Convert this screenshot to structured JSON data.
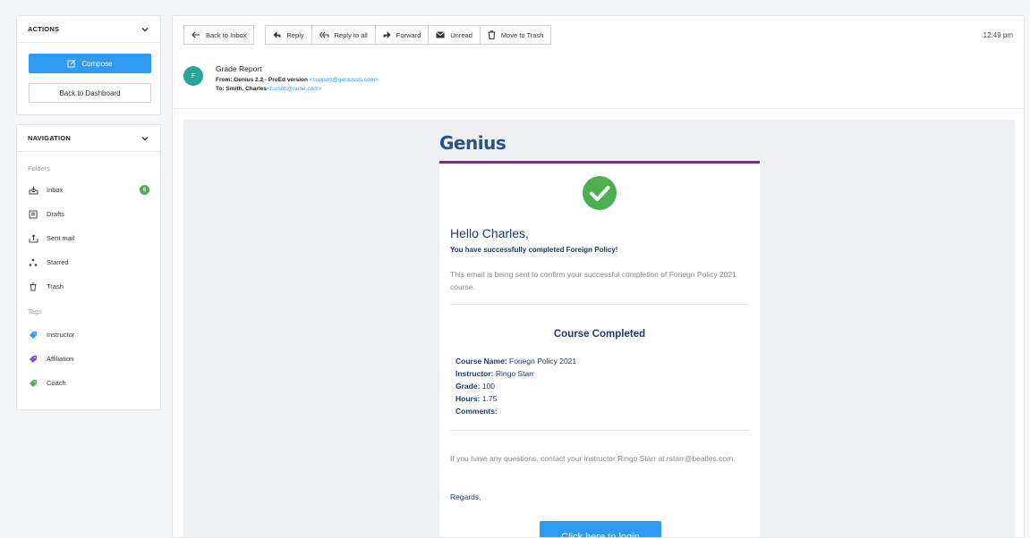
{
  "sidebar": {
    "actions": {
      "title": "ACTIONS",
      "compose_label": "Compose",
      "dashboard_label": "Back to Dashboard"
    },
    "navigation": {
      "title": "NAVIGATION",
      "folders_label": "Folders",
      "folders": [
        {
          "label": "Inbox",
          "icon": "inbox-icon",
          "badge": "6"
        },
        {
          "label": "Drafts",
          "icon": "drafts-icon"
        },
        {
          "label": "Sent mail",
          "icon": "sent-icon"
        },
        {
          "label": "Starred",
          "icon": "starred-icon"
        },
        {
          "label": "Trash",
          "icon": "trash-icon"
        }
      ],
      "tags_label": "Tags",
      "tags": [
        {
          "label": "Instructor",
          "color": "#2e9bf0"
        },
        {
          "label": "Affiliation",
          "color": "#7e57c2"
        },
        {
          "label": "Coach",
          "color": "#4caf50"
        }
      ]
    }
  },
  "toolbar": {
    "back_label": "Back to Inbox",
    "reply_label": "Reply",
    "reply_all_label": "Reply to all",
    "forward_label": "Forward",
    "unread_label": "Unread",
    "trash_label": "Move to Trash",
    "time": "12:49 pm"
  },
  "message": {
    "avatar_letter": "F",
    "subject": "Grade Report",
    "from_prefix": "From: Genius 2.2 - ProEd version",
    "from_email": "<support@geniussis.com>",
    "to_prefix": "To: Smith, Charles",
    "to_email": "<csmith@none.com>"
  },
  "email": {
    "logo": "Genius",
    "greeting": "Hello Charles,",
    "success": "You have successfully completed Foreign Policy!",
    "intro": "This email is being sent to confirm your successful completion of Foriegn Policy 2021 course.",
    "completed_heading": "Course Completed",
    "course_name_label": "Course Name:",
    "course_name": "Foriegn Policy 2021",
    "instructor_label": "Instructor:",
    "instructor": "Ringo Starr",
    "grade_label": "Grade:",
    "grade": "100",
    "hours_label": "Hours:",
    "hours": "1.75",
    "comments_label": "Comments:",
    "contact": "If you have any questions, contact your instructor Ringo Starr at rstarr@beatles.com.",
    "regards": "Regards,",
    "login_label": "Click here to login"
  },
  "colors": {
    "accent": "#2e9bf0",
    "brand_bar": "#7b2d8e",
    "heading": "#1f3a6b",
    "success": "#4caf50"
  }
}
